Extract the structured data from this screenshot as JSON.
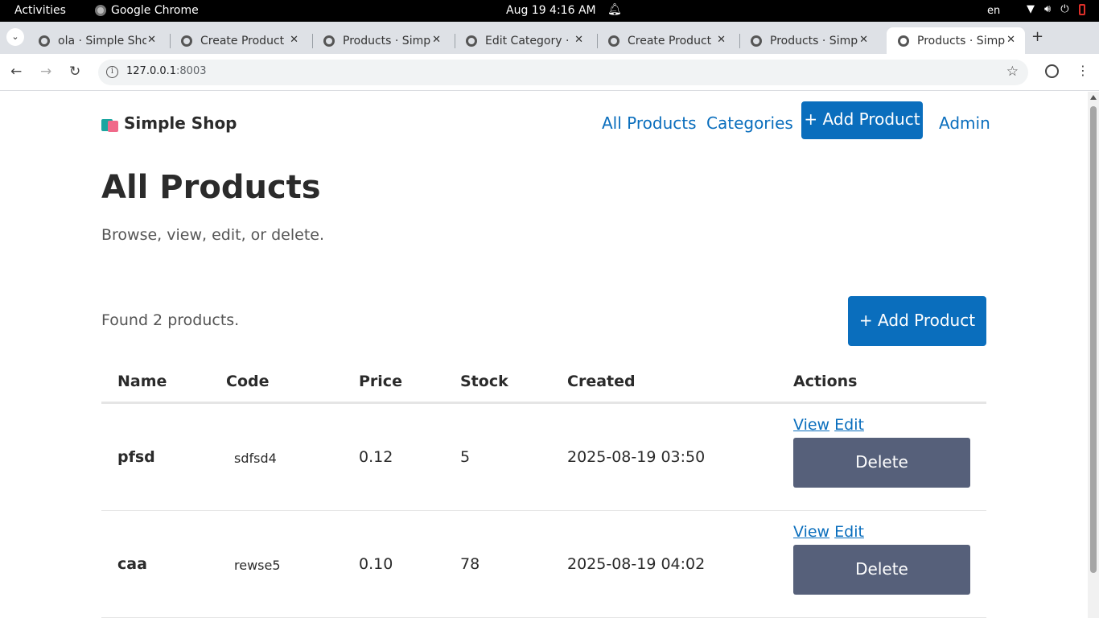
{
  "system_bar": {
    "activities": "Activities",
    "app_name": "Google Chrome",
    "clock": "Aug 19   4:16 AM",
    "lang": "en"
  },
  "tabs": [
    {
      "title": "ola · Simple Sho"
    },
    {
      "title": "Create Product"
    },
    {
      "title": "Products · Simp"
    },
    {
      "title": "Edit Category ·"
    },
    {
      "title": "Create Product"
    },
    {
      "title": "Products · Simp"
    },
    {
      "title": "Products · Simp"
    }
  ],
  "address_bar": {
    "host": "127.0.0.1",
    "port": ":8003"
  },
  "site": {
    "brand": "Simple Shop",
    "nav": {
      "all_products": "All Products",
      "categories": "Categories",
      "add_product": "+ Add Product",
      "admin": "Admin"
    }
  },
  "main": {
    "title": "All Products",
    "subtitle": "Browse, view, edit, or delete.",
    "found_text": "Found 2 products.",
    "add_button": "+ Add Product",
    "columns": [
      "Name",
      "Code",
      "Price",
      "Stock",
      "Created",
      "Actions"
    ],
    "rows": [
      {
        "name": "pfsd",
        "code": "sdfsd4",
        "price": "0.12",
        "stock": "5",
        "created": "2025-08-19 03:50",
        "view": "View",
        "edit": "Edit",
        "delete": "Delete"
      },
      {
        "name": "caa",
        "code": "rewse5",
        "price": "0.10",
        "stock": "78",
        "created": "2025-08-19 04:02",
        "view": "View",
        "edit": "Edit",
        "delete": "Delete"
      }
    ]
  },
  "colors": {
    "accent": "#0a6ebd",
    "delete_button": "#56607a"
  }
}
